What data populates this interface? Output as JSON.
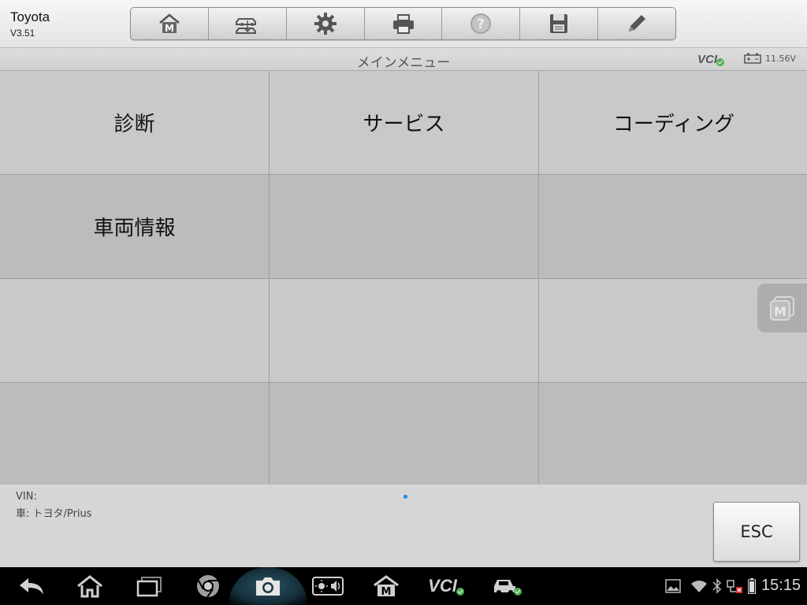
{
  "app": {
    "name": "Toyota",
    "version": "V3.51"
  },
  "toolbar": {
    "items": [
      {
        "icon": "home-m-icon"
      },
      {
        "icon": "vehicle-swap-icon"
      },
      {
        "icon": "gear-icon"
      },
      {
        "icon": "printer-icon"
      },
      {
        "icon": "help-icon"
      },
      {
        "icon": "save-icon"
      },
      {
        "icon": "pencil-icon"
      }
    ]
  },
  "titlebar": {
    "title": "メインメニュー",
    "vci_label": "VCI",
    "voltage": "11.56V"
  },
  "menu": {
    "cells": [
      "診断",
      "サービス",
      "コーディング",
      "車両情報",
      "",
      "",
      "",
      "",
      "",
      "",
      "",
      ""
    ]
  },
  "footer": {
    "vin_label": "VIN:",
    "car_label": "車: トヨタ/Prius",
    "esc_label": "ESC"
  },
  "navbar": {
    "vci_label": "VCI",
    "clock": "15:15"
  },
  "colors": {
    "accent": "#1e88e5",
    "ok": "#4caf50",
    "header_bg": "#eeeeee",
    "navbar_bg": "#000000"
  }
}
